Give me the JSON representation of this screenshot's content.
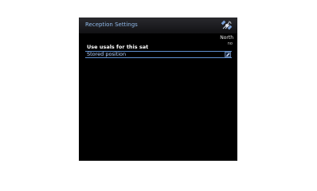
{
  "window": {
    "title": "Reception Settings",
    "icon": "satellite-icon"
  },
  "panel": {
    "header_label": "North",
    "header_value": "no",
    "items": [
      {
        "label": "Use usals for this sat"
      },
      {
        "label": "Stored position",
        "icon": "edit-icon",
        "selected": true
      }
    ]
  },
  "colors": {
    "background": "#000000",
    "title_text": "#8fb8e8",
    "selection_border": "#5f8fd0",
    "selection_text": "#b6d3ff"
  }
}
